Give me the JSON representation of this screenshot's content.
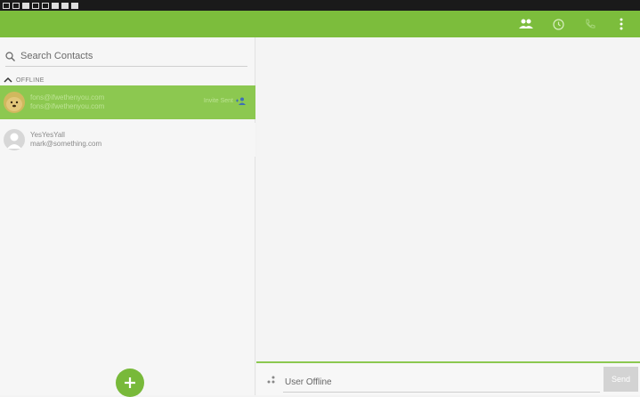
{
  "search": {
    "placeholder": "Search Contacts"
  },
  "contacts": {
    "section_label": "OFFLINE",
    "items": [
      {
        "name": "fons@ifwethenyou.com",
        "email": "fons@ifwethenyou.com",
        "status": "Invite Sent",
        "selected": true,
        "avatar_icon": "doge-avatar-icon"
      },
      {
        "name": "YesYesYall",
        "email": "mark@something.com",
        "selected": false,
        "avatar_icon": "default-avatar-icon"
      }
    ]
  },
  "toolbar": {
    "icons": [
      "contacts-icon",
      "history-icon",
      "call-icon",
      "more-icon"
    ]
  },
  "chat": {
    "input_placeholder": "User Offline",
    "send_label": "Send"
  },
  "colors": {
    "accent": "#7cbd3c",
    "selected_row": "#8cc850",
    "send_disabled": "#d3d3d3"
  }
}
